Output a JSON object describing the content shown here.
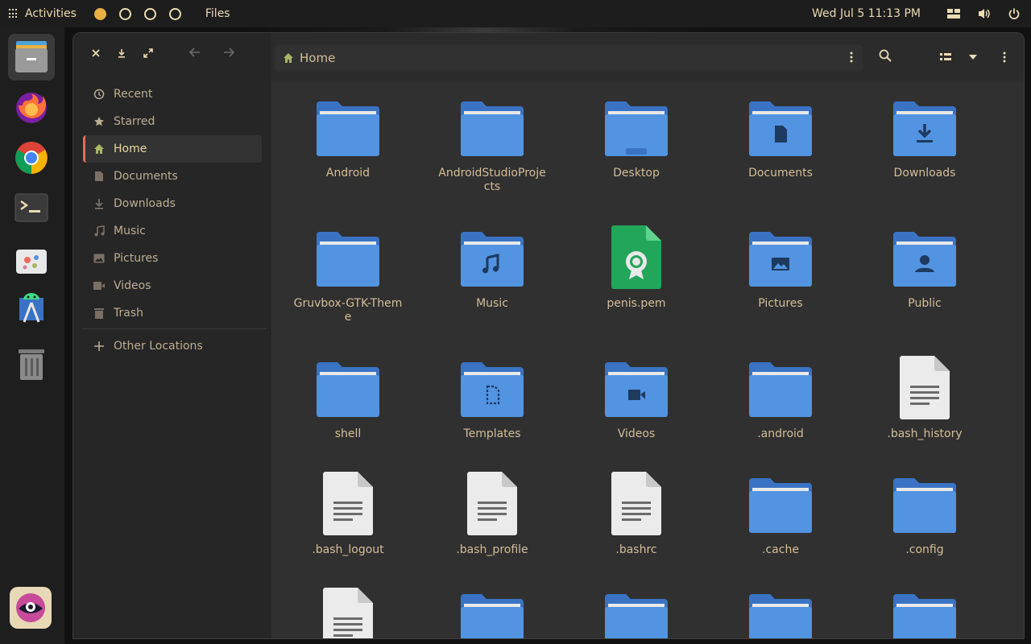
{
  "topbar": {
    "activities": "Activities",
    "app_name": "Files",
    "clock": "Wed Jul 5  11:13 PM"
  },
  "dock": [
    {
      "name": "files-dock-icon"
    },
    {
      "name": "firefox-dock-icon"
    },
    {
      "name": "chrome-dock-icon"
    },
    {
      "name": "terminal-dock-icon"
    },
    {
      "name": "app-dock-icon"
    },
    {
      "name": "android-studio-dock-icon"
    },
    {
      "name": "trash-dock-icon"
    },
    {
      "name": "user-app-dock-icon"
    }
  ],
  "sidebar": {
    "places": [
      {
        "label": "Recent",
        "icon": "clock-icon"
      },
      {
        "label": "Starred",
        "icon": "star-icon"
      },
      {
        "label": "Home",
        "icon": "home-icon"
      },
      {
        "label": "Documents",
        "icon": "document-icon"
      },
      {
        "label": "Downloads",
        "icon": "download-icon"
      },
      {
        "label": "Music",
        "icon": "music-icon"
      },
      {
        "label": "Pictures",
        "icon": "picture-icon"
      },
      {
        "label": "Videos",
        "icon": "video-icon"
      },
      {
        "label": "Trash",
        "icon": "trash-icon"
      }
    ],
    "other_locations": "Other Locations"
  },
  "pathbar": {
    "current": "Home"
  },
  "files": [
    {
      "name": "Android",
      "type": "folder"
    },
    {
      "name": "AndroidStudioProjects",
      "type": "folder"
    },
    {
      "name": "Desktop",
      "type": "folder-desktop"
    },
    {
      "name": "Documents",
      "type": "folder-documents"
    },
    {
      "name": "Downloads",
      "type": "folder-downloads"
    },
    {
      "name": "Gruvbox-GTK-Theme",
      "type": "folder"
    },
    {
      "name": "Music",
      "type": "folder-music"
    },
    {
      "name": "penis.pem",
      "type": "certificate"
    },
    {
      "name": "Pictures",
      "type": "folder-pictures"
    },
    {
      "name": "Public",
      "type": "folder-public"
    },
    {
      "name": "shell",
      "type": "folder"
    },
    {
      "name": "Templates",
      "type": "folder-templates"
    },
    {
      "name": "Videos",
      "type": "folder-videos"
    },
    {
      "name": ".android",
      "type": "folder"
    },
    {
      "name": ".bash_history",
      "type": "text"
    },
    {
      "name": ".bash_logout",
      "type": "text"
    },
    {
      "name": ".bash_profile",
      "type": "text"
    },
    {
      "name": ".bashrc",
      "type": "text"
    },
    {
      "name": ".cache",
      "type": "folder"
    },
    {
      "name": ".config",
      "type": "folder"
    },
    {
      "name": "",
      "type": "text"
    },
    {
      "name": "",
      "type": "folder"
    },
    {
      "name": "",
      "type": "folder"
    },
    {
      "name": "",
      "type": "folder"
    },
    {
      "name": "",
      "type": "folder"
    }
  ],
  "colors": {
    "folder": "#5294e2",
    "folder_dark": "#3a73c4",
    "accent": "#ea6962",
    "text": "#d4be98"
  }
}
